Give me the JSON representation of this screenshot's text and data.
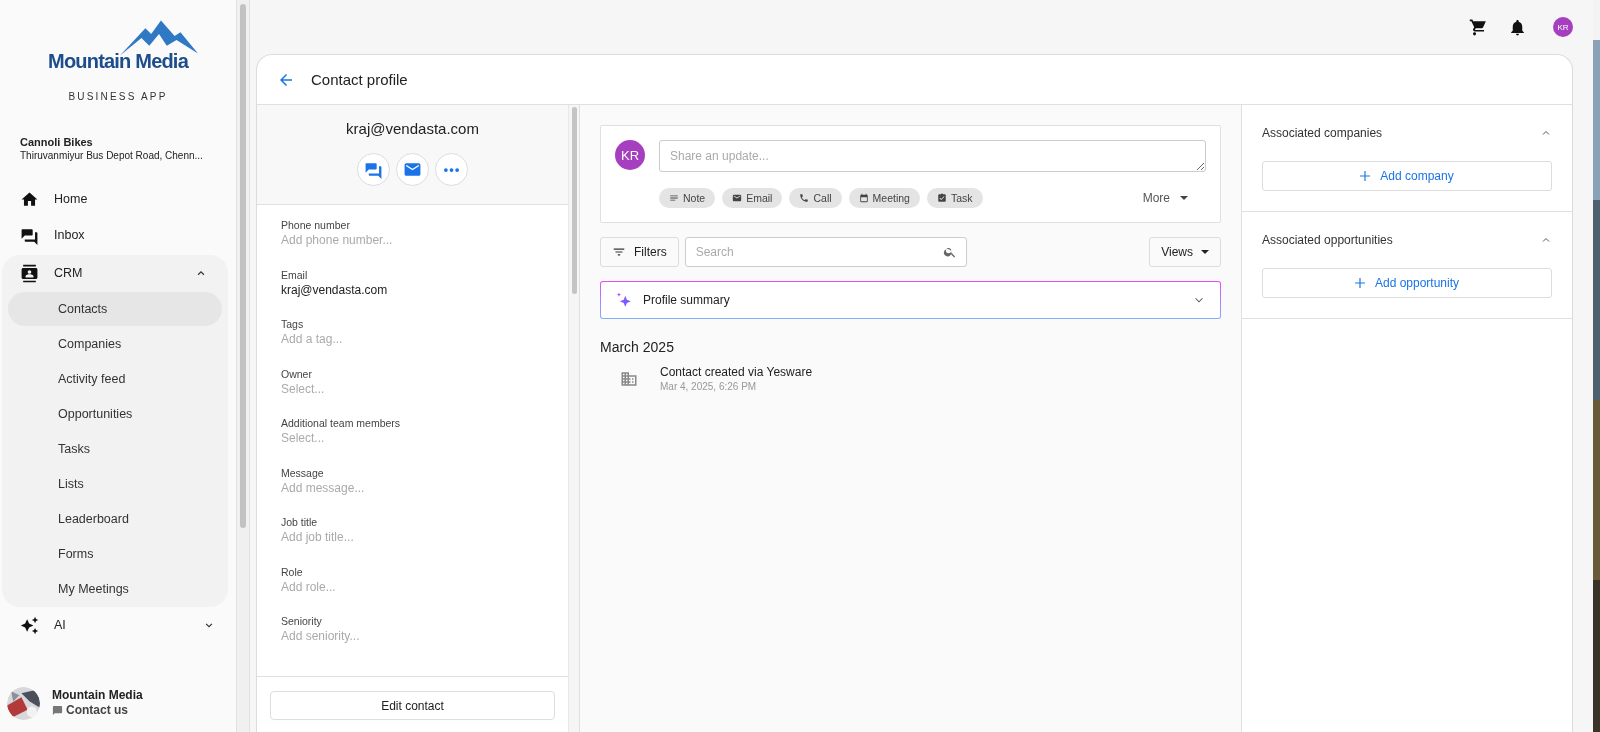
{
  "sidebar": {
    "logo": {
      "name": "Mountain Media",
      "subtitle": "BUSINESS APP"
    },
    "account": {
      "name": "Cannoli Bikes",
      "address": "Thiruvanmiyur Bus Depot Road, Chenn..."
    },
    "nav": [
      {
        "label": "Home"
      },
      {
        "label": "Inbox"
      },
      {
        "label": "CRM",
        "expanded": true,
        "children": [
          {
            "label": "Contacts",
            "selected": true
          },
          {
            "label": "Companies",
            "selected": false
          },
          {
            "label": "Activity feed",
            "selected": false
          },
          {
            "label": "Opportunities",
            "selected": false
          },
          {
            "label": "Tasks",
            "selected": false
          },
          {
            "label": "Lists",
            "selected": false
          },
          {
            "label": "Leaderboard",
            "selected": false
          },
          {
            "label": "Forms",
            "selected": false
          },
          {
            "label": "My Meetings",
            "selected": false
          }
        ]
      },
      {
        "label": "AI",
        "expanded": false
      }
    ],
    "footer": {
      "name": "Mountain Media",
      "link": "Contact us"
    }
  },
  "top_bar": {
    "avatar": "KR"
  },
  "page": {
    "title": "Contact profile"
  },
  "contact": {
    "heading": "kraj@vendasta.com",
    "fields": [
      {
        "label": "Phone number",
        "placeholder": "Add phone number..."
      },
      {
        "label": "Email",
        "value": "kraj@vendasta.com"
      },
      {
        "label": "Tags",
        "placeholder": "Add a tag..."
      },
      {
        "label": "Owner",
        "placeholder": "Select..."
      },
      {
        "label": "Additional team members",
        "placeholder": "Select..."
      },
      {
        "label": "Message",
        "placeholder": "Add message..."
      },
      {
        "label": "Job title",
        "placeholder": "Add job title..."
      },
      {
        "label": "Role",
        "placeholder": "Add role..."
      },
      {
        "label": "Seniority",
        "placeholder": "Add seniority..."
      }
    ],
    "edit_button": "Edit contact"
  },
  "composer": {
    "avatar": "KR",
    "placeholder": "Share an update...",
    "actions": [
      "Note",
      "Email",
      "Call",
      "Meeting",
      "Task"
    ],
    "more": "More"
  },
  "filters": {
    "button": "Filters",
    "search_placeholder": "Search",
    "views": "Views"
  },
  "summary": {
    "title": "Profile summary",
    "expanded": false
  },
  "timeline": {
    "month": "March 2025",
    "entries": [
      {
        "title": "Contact created via Yesware",
        "time": "Mar 4, 2025, 6:26 PM"
      }
    ]
  },
  "associations": [
    {
      "title": "Associated companies",
      "expanded": true,
      "button": "Add company"
    },
    {
      "title": "Associated opportunities",
      "expanded": true,
      "button": "Add opportunity"
    }
  ]
}
